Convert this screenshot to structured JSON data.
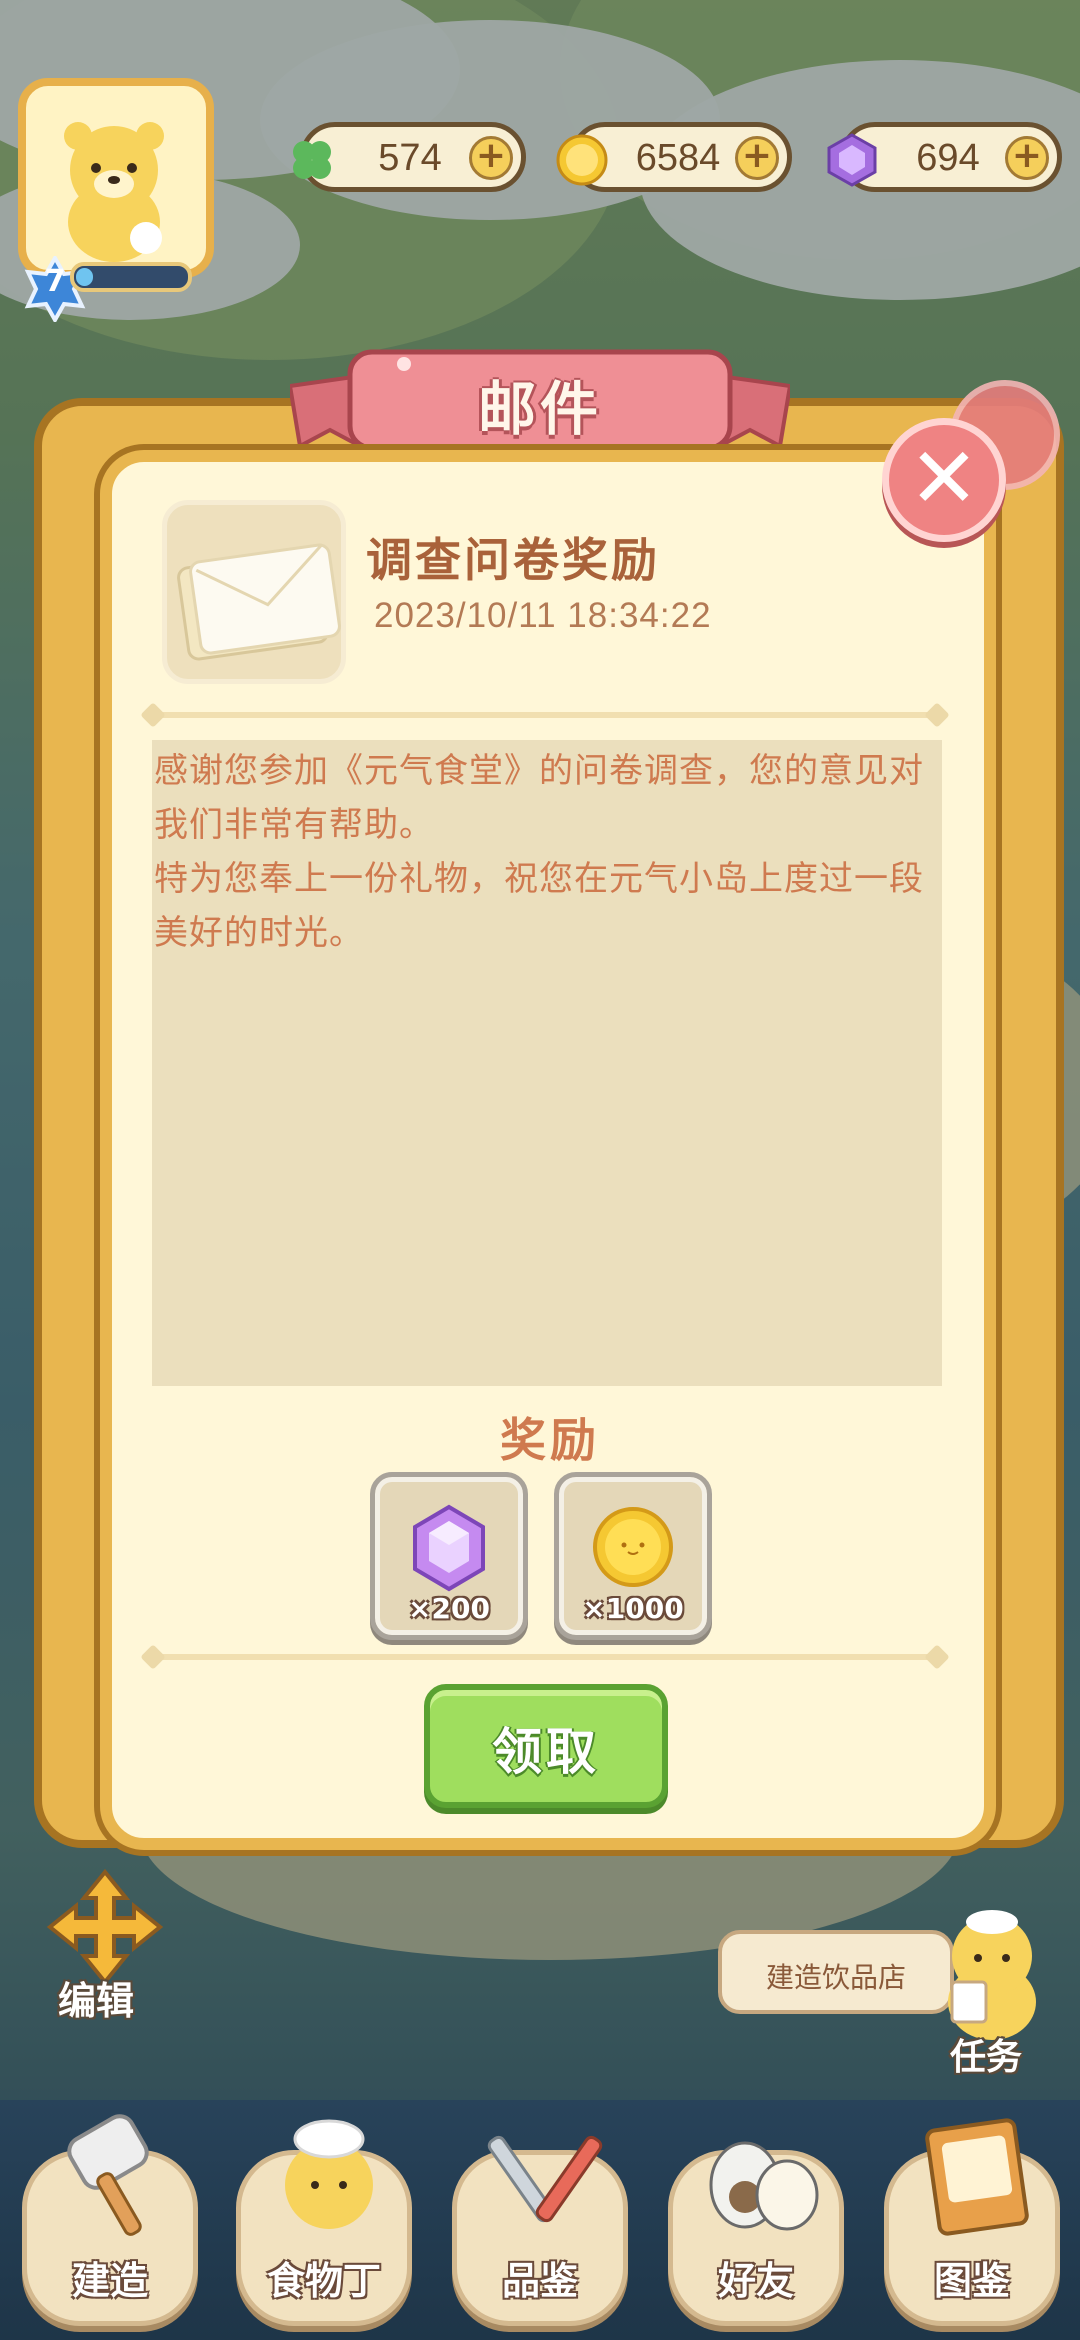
{
  "hud": {
    "level": "7",
    "xp_progress": 0.15,
    "resources": [
      {
        "name": "clover",
        "icon": "clover-icon",
        "value": "574"
      },
      {
        "name": "coin",
        "icon": "coin-icon",
        "value": "6584"
      },
      {
        "name": "gem",
        "icon": "gem-icon",
        "value": "694"
      }
    ]
  },
  "dialog": {
    "title": "邮件",
    "mail": {
      "title": "调查问卷奖励",
      "date": "2023/10/11 18:34:22",
      "body": "感谢您参加《元气食堂》的问卷调查，您的意见对我们非常有帮助。\n特为您奉上一份礼物，祝您在元气小岛上度过一段美好的时光。"
    },
    "reward_label": "奖励",
    "rewards": [
      {
        "item": "gem",
        "quantity": "×200"
      },
      {
        "item": "coin",
        "quantity": "×1000"
      }
    ],
    "claim_button": "领取",
    "close_symbol": "✕"
  },
  "scene": {
    "edit_label": "编辑",
    "build_shop_label": "建造饮品店",
    "task_label": "任务"
  },
  "nav": [
    {
      "label": "建造",
      "icon": "hammer-icon"
    },
    {
      "label": "食物丁",
      "icon": "chef-bear-icon"
    },
    {
      "label": "品鉴",
      "icon": "utensils-icon"
    },
    {
      "label": "好友",
      "icon": "friends-icon"
    },
    {
      "label": "图鉴",
      "icon": "book-icon"
    }
  ],
  "colors": {
    "frame_gold": "#e8b64f",
    "parchment": "#fff7d8",
    "text_orange": "#cf7a4f",
    "claim_green": "#9fde5e",
    "close_pink": "#ef8383"
  }
}
